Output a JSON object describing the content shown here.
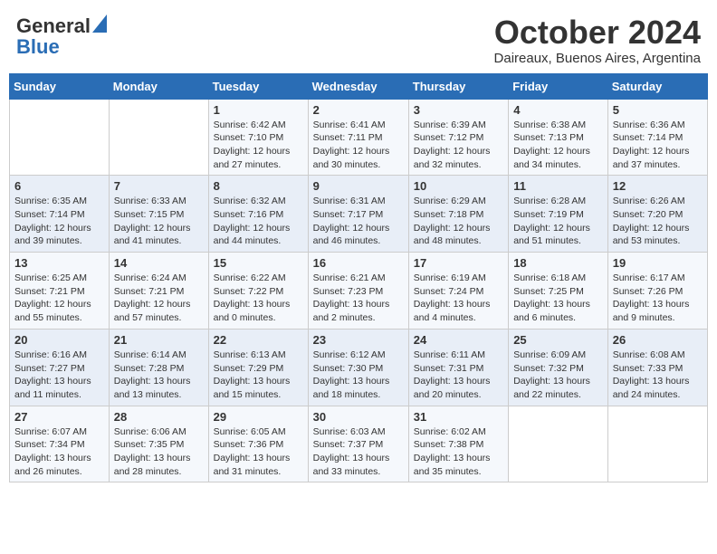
{
  "header": {
    "logo_general": "General",
    "logo_blue": "Blue",
    "month_title": "October 2024",
    "location": "Daireaux, Buenos Aires, Argentina"
  },
  "days_of_week": [
    "Sunday",
    "Monday",
    "Tuesday",
    "Wednesday",
    "Thursday",
    "Friday",
    "Saturday"
  ],
  "weeks": [
    [
      {
        "day": "",
        "info": ""
      },
      {
        "day": "",
        "info": ""
      },
      {
        "day": "1",
        "info": "Sunrise: 6:42 AM\nSunset: 7:10 PM\nDaylight: 12 hours and 27 minutes."
      },
      {
        "day": "2",
        "info": "Sunrise: 6:41 AM\nSunset: 7:11 PM\nDaylight: 12 hours and 30 minutes."
      },
      {
        "day": "3",
        "info": "Sunrise: 6:39 AM\nSunset: 7:12 PM\nDaylight: 12 hours and 32 minutes."
      },
      {
        "day": "4",
        "info": "Sunrise: 6:38 AM\nSunset: 7:13 PM\nDaylight: 12 hours and 34 minutes."
      },
      {
        "day": "5",
        "info": "Sunrise: 6:36 AM\nSunset: 7:14 PM\nDaylight: 12 hours and 37 minutes."
      }
    ],
    [
      {
        "day": "6",
        "info": "Sunrise: 6:35 AM\nSunset: 7:14 PM\nDaylight: 12 hours and 39 minutes."
      },
      {
        "day": "7",
        "info": "Sunrise: 6:33 AM\nSunset: 7:15 PM\nDaylight: 12 hours and 41 minutes."
      },
      {
        "day": "8",
        "info": "Sunrise: 6:32 AM\nSunset: 7:16 PM\nDaylight: 12 hours and 44 minutes."
      },
      {
        "day": "9",
        "info": "Sunrise: 6:31 AM\nSunset: 7:17 PM\nDaylight: 12 hours and 46 minutes."
      },
      {
        "day": "10",
        "info": "Sunrise: 6:29 AM\nSunset: 7:18 PM\nDaylight: 12 hours and 48 minutes."
      },
      {
        "day": "11",
        "info": "Sunrise: 6:28 AM\nSunset: 7:19 PM\nDaylight: 12 hours and 51 minutes."
      },
      {
        "day": "12",
        "info": "Sunrise: 6:26 AM\nSunset: 7:20 PM\nDaylight: 12 hours and 53 minutes."
      }
    ],
    [
      {
        "day": "13",
        "info": "Sunrise: 6:25 AM\nSunset: 7:21 PM\nDaylight: 12 hours and 55 minutes."
      },
      {
        "day": "14",
        "info": "Sunrise: 6:24 AM\nSunset: 7:21 PM\nDaylight: 12 hours and 57 minutes."
      },
      {
        "day": "15",
        "info": "Sunrise: 6:22 AM\nSunset: 7:22 PM\nDaylight: 13 hours and 0 minutes."
      },
      {
        "day": "16",
        "info": "Sunrise: 6:21 AM\nSunset: 7:23 PM\nDaylight: 13 hours and 2 minutes."
      },
      {
        "day": "17",
        "info": "Sunrise: 6:19 AM\nSunset: 7:24 PM\nDaylight: 13 hours and 4 minutes."
      },
      {
        "day": "18",
        "info": "Sunrise: 6:18 AM\nSunset: 7:25 PM\nDaylight: 13 hours and 6 minutes."
      },
      {
        "day": "19",
        "info": "Sunrise: 6:17 AM\nSunset: 7:26 PM\nDaylight: 13 hours and 9 minutes."
      }
    ],
    [
      {
        "day": "20",
        "info": "Sunrise: 6:16 AM\nSunset: 7:27 PM\nDaylight: 13 hours and 11 minutes."
      },
      {
        "day": "21",
        "info": "Sunrise: 6:14 AM\nSunset: 7:28 PM\nDaylight: 13 hours and 13 minutes."
      },
      {
        "day": "22",
        "info": "Sunrise: 6:13 AM\nSunset: 7:29 PM\nDaylight: 13 hours and 15 minutes."
      },
      {
        "day": "23",
        "info": "Sunrise: 6:12 AM\nSunset: 7:30 PM\nDaylight: 13 hours and 18 minutes."
      },
      {
        "day": "24",
        "info": "Sunrise: 6:11 AM\nSunset: 7:31 PM\nDaylight: 13 hours and 20 minutes."
      },
      {
        "day": "25",
        "info": "Sunrise: 6:09 AM\nSunset: 7:32 PM\nDaylight: 13 hours and 22 minutes."
      },
      {
        "day": "26",
        "info": "Sunrise: 6:08 AM\nSunset: 7:33 PM\nDaylight: 13 hours and 24 minutes."
      }
    ],
    [
      {
        "day": "27",
        "info": "Sunrise: 6:07 AM\nSunset: 7:34 PM\nDaylight: 13 hours and 26 minutes."
      },
      {
        "day": "28",
        "info": "Sunrise: 6:06 AM\nSunset: 7:35 PM\nDaylight: 13 hours and 28 minutes."
      },
      {
        "day": "29",
        "info": "Sunrise: 6:05 AM\nSunset: 7:36 PM\nDaylight: 13 hours and 31 minutes."
      },
      {
        "day": "30",
        "info": "Sunrise: 6:03 AM\nSunset: 7:37 PM\nDaylight: 13 hours and 33 minutes."
      },
      {
        "day": "31",
        "info": "Sunrise: 6:02 AM\nSunset: 7:38 PM\nDaylight: 13 hours and 35 minutes."
      },
      {
        "day": "",
        "info": ""
      },
      {
        "day": "",
        "info": ""
      }
    ]
  ]
}
